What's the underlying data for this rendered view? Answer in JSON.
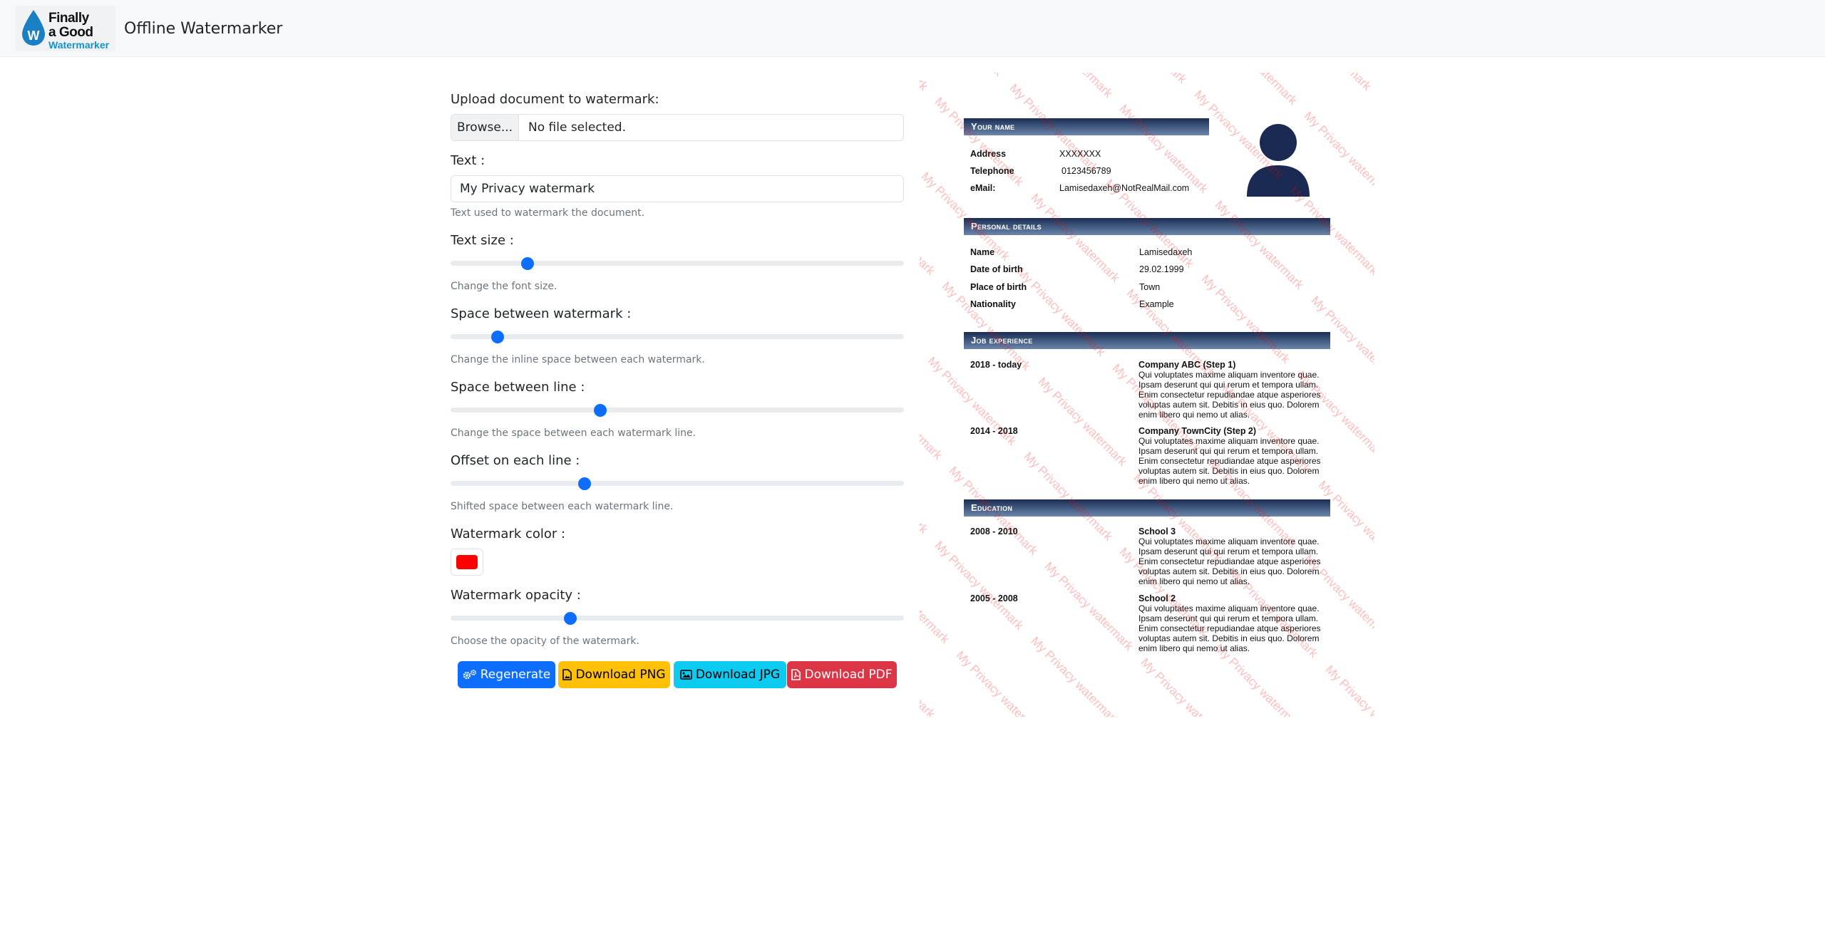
{
  "navbar": {
    "logo": {
      "line1": "Finally",
      "line2": "a Good",
      "line3": "Watermarker",
      "letter": "W"
    },
    "title": "Offline Watermarker"
  },
  "form": {
    "upload": {
      "label": "Upload document to watermark:",
      "button": "Browse...",
      "file_status": "No file selected."
    },
    "text": {
      "label": "Text :",
      "value": "My Privacy watermark",
      "help": "Text used to watermark the document."
    },
    "text_size": {
      "label": "Text size :",
      "value_fraction": 0.16,
      "help": "Change the font size."
    },
    "space_watermark": {
      "label": "Space between watermark :",
      "value_fraction": 0.092,
      "help": "Change the inline space between each watermark."
    },
    "space_line": {
      "label": "Space between line :",
      "value_fraction": 0.325,
      "help": "Change the space between each watermark line."
    },
    "offset": {
      "label": "Offset on each line :",
      "value_fraction": 0.29,
      "help": "Shifted space between each watermark line."
    },
    "color": {
      "label": "Watermark color :",
      "value": "#ff0000"
    },
    "opacity": {
      "label": "Watermark opacity :",
      "value_fraction": 0.258,
      "help": "Choose the opacity of the watermark."
    }
  },
  "buttons": [
    {
      "label": "Regenerate",
      "icon": "gears-icon",
      "style": "primary"
    },
    {
      "label": "Download PNG",
      "icon": "file-image-icon",
      "style": "warning"
    },
    {
      "label": "Download JPG",
      "icon": "image-icon",
      "style": "info"
    },
    {
      "label": "Download PDF",
      "icon": "file-pdf-icon",
      "style": "danger"
    }
  ],
  "preview": {
    "watermark_text": "My Privacy watermark",
    "watermark_color": "#ff0000",
    "header_color": "#2c4168",
    "sections": {
      "your_name": "Your name",
      "personal": "Personal details",
      "job": "Job experience",
      "education": "Education"
    },
    "contact": [
      {
        "key": "Address",
        "value": "XXXXXXX"
      },
      {
        "key": "Telephone",
        "value": "0123456789"
      },
      {
        "key": "eMail:",
        "value": "Lamisedaxeh@NotRealMail.com"
      }
    ],
    "personal": [
      {
        "key": "Name",
        "value": "Lamisedaxeh"
      },
      {
        "key": "Date of birth",
        "value": "29.02.1999"
      },
      {
        "key": "Place of birth",
        "value": "Town"
      },
      {
        "key": "Nationality",
        "value": "Example"
      }
    ],
    "jobs": [
      {
        "period": "2018 - today",
        "title": "Company ABC (Step 1)",
        "text": "Qui voluptates maxime aliquam inventore quae. Ipsam deserunt qui qui rerum et tempora ullam. Enim consectetur repudiandae atque asperiores voluptas autem sit. Debitis in eius quo. Dolorem enim libero qui nemo ut alias."
      },
      {
        "period": "2014 - 2018",
        "title": "Company TownCity (Step 2)",
        "text": "Qui voluptates maxime aliquam inventore quae. Ipsam deserunt qui qui rerum et tempora ullam. Enim consectetur repudiandae atque asperiores voluptas autem sit. Debitis in eius quo. Dolorem enim libero qui nemo ut alias."
      }
    ],
    "education": [
      {
        "period": "2008 - 2010",
        "title": "School 3",
        "text": "Qui voluptates maxime aliquam inventore quae. Ipsam deserunt qui qui rerum et tempora ullam. Enim consectetur repudiandae atque asperiores voluptas autem sit. Debitis in eius quo. Dolorem enim libero qui nemo ut alias."
      },
      {
        "period": "2005 - 2008",
        "title": "School 2",
        "text": "Qui voluptates maxime aliquam inventore quae. Ipsam deserunt qui qui rerum et tempora ullam. Enim consectetur repudiandae atque asperiores voluptas autem sit. Debitis in eius quo. Dolorem enim libero qui nemo ut alias."
      }
    ]
  }
}
